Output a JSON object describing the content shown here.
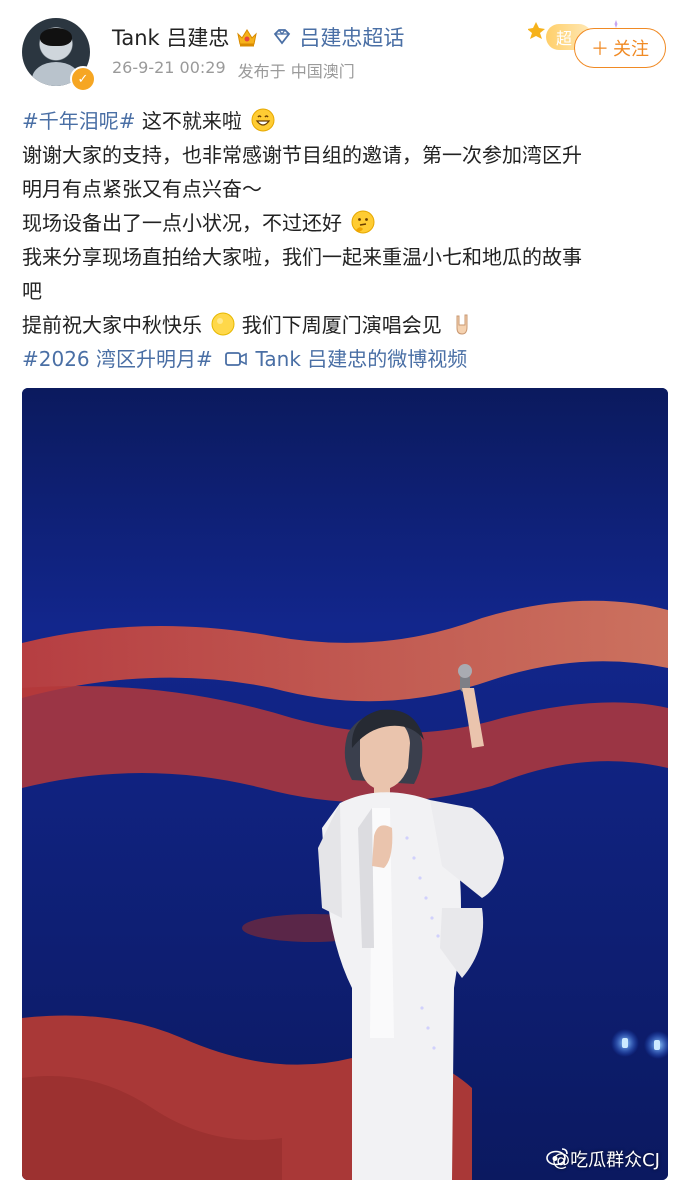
{
  "header": {
    "username": "Tank 吕建忠",
    "crown_icon": "crown-icon",
    "diamond_icon": "diamond-icon",
    "super_topic": "吕建忠超话",
    "timestamp": "26-9-21 00:29",
    "posted_from_label": "发布于",
    "location": "中国澳门",
    "super_badge_text": "超",
    "follow_button": "关注",
    "colors": {
      "accent": "#f08a24",
      "link": "#4a6fa5",
      "meta": "#9a9a9a",
      "verified": "#f6a623"
    }
  },
  "post": {
    "hashtag1": "#千年泪呢#",
    "line1_text": "这不就来啦",
    "line2": "谢谢大家的支持，也非常感谢节目组的邀请，第一次参加湾区升",
    "line3": "明月有点紧张又有点兴奋～",
    "line4": "现场设备出了一点小状况，不过还好",
    "line5": "我来分享现场直拍给大家啦，我们一起来重温小七和地瓜的故事",
    "line6": "吧",
    "line7_a": "提前祝大家中秋快乐",
    "line7_b": "我们下周厦门演唱会见",
    "hashtag2": "#2026 湾区升明月#",
    "video_link": "Tank 吕建忠的微博视频",
    "emojis": [
      "grin-emoji",
      "thinking-emoji",
      "moon-emoji",
      "rock-hand-emoji"
    ]
  },
  "media": {
    "watermark": "@吃瓜群众CJ",
    "watermark_icon": "weibo-icon"
  }
}
